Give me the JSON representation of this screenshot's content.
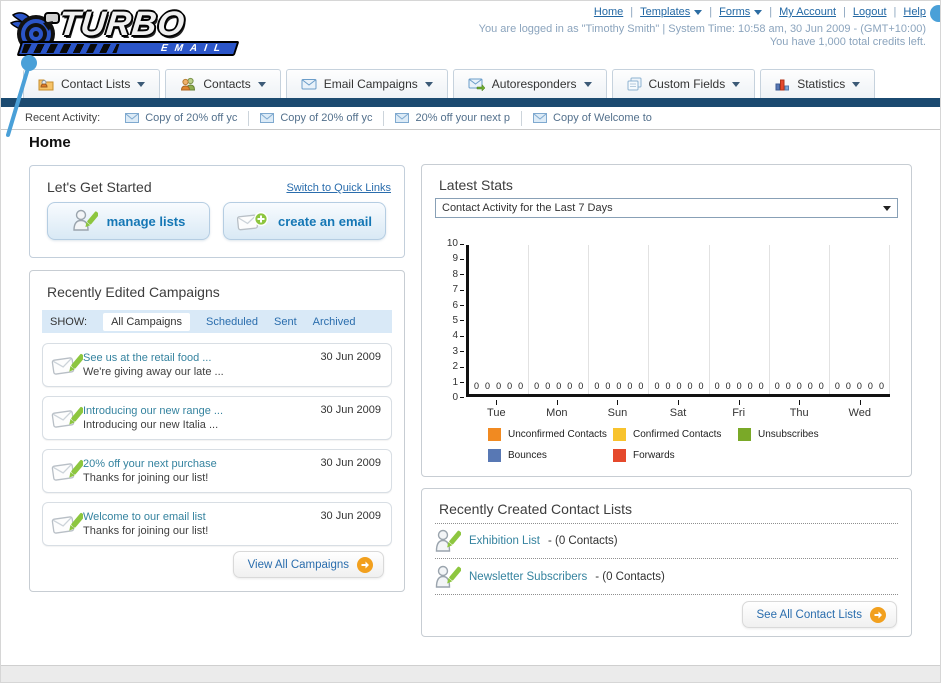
{
  "brand": {
    "name": "TURBO",
    "sub": "EMAIL"
  },
  "header": {
    "links": [
      {
        "label": "Home",
        "dropdown": false
      },
      {
        "label": "Templates",
        "dropdown": true
      },
      {
        "label": "Forms",
        "dropdown": true
      },
      {
        "label": "My Account",
        "dropdown": false
      },
      {
        "label": "Logout",
        "dropdown": false
      },
      {
        "label": "Help",
        "dropdown": false
      }
    ],
    "separator": "|",
    "login_info": "You are logged in as \"Timothy Smith\" | System Time: 10:58 am, 30 Jun 2009 - (GMT+10:00)",
    "credits_info": "You have 1,000 total credits left."
  },
  "nav_tabs": [
    {
      "label": "Contact Lists",
      "icon": "folder-contacts-icon"
    },
    {
      "label": "Contacts",
      "icon": "contacts-icon"
    },
    {
      "label": "Email Campaigns",
      "icon": "envelope-icon"
    },
    {
      "label": "Autoresponders",
      "icon": "envelope-arrow-icon"
    },
    {
      "label": "Custom Fields",
      "icon": "pages-icon"
    },
    {
      "label": "Statistics",
      "icon": "bar-chart-icon"
    }
  ],
  "recent_activity": {
    "label": "Recent Activity:",
    "items": [
      {
        "label": "Copy of 20% off yc"
      },
      {
        "label": "Copy of 20% off yc"
      },
      {
        "label": "20% off your next p"
      },
      {
        "label": "Copy of Welcome to"
      }
    ]
  },
  "page_title": "Home",
  "get_started": {
    "title": "Let's Get Started",
    "switch_link": "Switch to Quick Links",
    "buttons": [
      {
        "label": "manage lists",
        "icon": "person-pencil-icon"
      },
      {
        "label": "create an email",
        "icon": "envelope-plus-icon"
      }
    ]
  },
  "campaigns": {
    "title": "Recently Edited Campaigns",
    "filter_label": "SHOW:",
    "filters": [
      {
        "label": "All Campaigns",
        "active": true
      },
      {
        "label": "Scheduled",
        "active": false
      },
      {
        "label": "Sent",
        "active": false
      },
      {
        "label": "Archived",
        "active": false
      }
    ],
    "items": [
      {
        "title": "See us at the retail food ...",
        "subtitle": "We're giving away our late ...",
        "date": "30 Jun 2009"
      },
      {
        "title": "Introducing our new range ...",
        "subtitle": "Introducing our new Italia ...",
        "date": "30 Jun 2009"
      },
      {
        "title": "20% off your next purchase",
        "subtitle": "Thanks for joining our list!",
        "date": "30 Jun 2009"
      },
      {
        "title": "Welcome to our email list",
        "subtitle": "Thanks for joining our list!",
        "date": "30 Jun 2009"
      }
    ],
    "view_all_label": "View All Campaigns"
  },
  "latest_stats": {
    "title": "Latest Stats",
    "selected_option": "Contact Activity for the Last 7 Days"
  },
  "chart_data": {
    "type": "bar",
    "title": "Contact Activity for the Last 7 Days",
    "categories": [
      "Tue",
      "Mon",
      "Sun",
      "Sat",
      "Fri",
      "Thu",
      "Wed"
    ],
    "series": [
      {
        "name": "Unconfirmed Contacts",
        "color": "#f18a21",
        "values": [
          0,
          0,
          0,
          0,
          0,
          0,
          0
        ]
      },
      {
        "name": "Confirmed Contacts",
        "color": "#f8c32d",
        "values": [
          0,
          0,
          0,
          0,
          0,
          0,
          0
        ]
      },
      {
        "name": "Unsubscribes",
        "color": "#7aa928",
        "values": [
          0,
          0,
          0,
          0,
          0,
          0,
          0
        ]
      },
      {
        "name": "Bounces",
        "color": "#5878b4",
        "values": [
          0,
          0,
          0,
          0,
          0,
          0,
          0
        ]
      },
      {
        "name": "Forwards",
        "color": "#e5492c",
        "values": [
          0,
          0,
          0,
          0,
          0,
          0,
          0
        ]
      }
    ],
    "ylim": [
      0,
      10
    ],
    "yticks": [
      0,
      1,
      2,
      3,
      4,
      5,
      6,
      7,
      8,
      9,
      10
    ],
    "grid": "vertical",
    "legend_position": "bottom",
    "show_value_labels": true
  },
  "contact_lists": {
    "title": "Recently Created Contact Lists",
    "items": [
      {
        "name": "Exhibition List",
        "detail": "- (0 Contacts)"
      },
      {
        "name": "Newsletter Subscribers",
        "detail": "- (0 Contacts)"
      }
    ],
    "see_all_label": "See All Contact Lists"
  },
  "colors": {
    "navy_bar": "#1b4a70",
    "link_blue": "#2a6dad",
    "link_teal": "#35839f",
    "filter_bar_bg": "#d9e9f7",
    "button_blue_text": "#1577b5",
    "orange_arrow": "#f2a01e",
    "callout_blue": "#4aa0d8"
  }
}
